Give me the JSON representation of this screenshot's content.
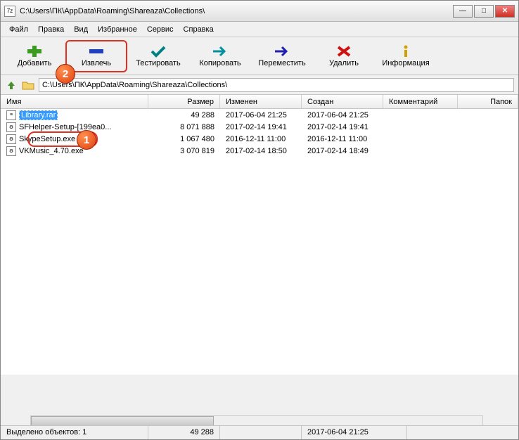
{
  "title": "C:\\Users\\ПК\\AppData\\Roaming\\Shareaza\\Collections\\",
  "app_icon_text": "7z",
  "menu": [
    "Файл",
    "Правка",
    "Вид",
    "Избранное",
    "Сервис",
    "Справка"
  ],
  "toolbar": {
    "add": "Добавить",
    "extract": "Извлечь",
    "test": "Тестировать",
    "copy": "Копировать",
    "move": "Переместить",
    "delete": "Удалить",
    "info": "Информация"
  },
  "address": "C:\\Users\\ПК\\AppData\\Roaming\\Shareaza\\Collections\\",
  "cols": {
    "name": "Имя",
    "size": "Размер",
    "modified": "Изменен",
    "created": "Создан",
    "comment": "Комментарий",
    "folders": "Папок"
  },
  "rows": [
    {
      "name": "Library.rar",
      "size": "49 288",
      "modified": "2017-06-04 21:25",
      "created": "2017-06-04 21:25",
      "selected": true,
      "icon": "rar"
    },
    {
      "name": "SFHelper-Setup-[199ea0...",
      "size": "8 071 888",
      "modified": "2017-02-14 19:41",
      "created": "2017-02-14 19:41",
      "icon": "exe"
    },
    {
      "name": "SkypeSetup.exe",
      "size": "1 067 480",
      "modified": "2016-12-11 11:00",
      "created": "2016-12-11 11:00",
      "icon": "exe"
    },
    {
      "name": "VKMusic_4.70.exe",
      "size": "3 070 819",
      "modified": "2017-02-14 18:50",
      "created": "2017-02-14 18:49",
      "icon": "exe"
    }
  ],
  "status": {
    "selection": "Выделено объектов: 1",
    "size": "49 288",
    "date": "2017-06-04 21:25"
  },
  "badges": {
    "b1": "1",
    "b2": "2"
  }
}
